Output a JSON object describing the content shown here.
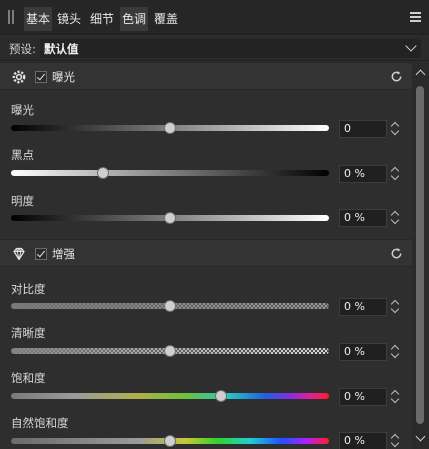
{
  "tabs": [
    {
      "label": "基本",
      "active": true
    },
    {
      "label": "镜头",
      "active": false
    },
    {
      "label": "细节",
      "active": false
    },
    {
      "label": "色调",
      "active": false
    },
    {
      "label": "覆盖",
      "active": false
    }
  ],
  "preset": {
    "label": "预设:",
    "value": "默认值"
  },
  "sections": {
    "exposure": {
      "title": "曝光",
      "enabled": true,
      "controls": {
        "exposure": {
          "label": "曝光",
          "value": "0",
          "level": 0.5
        },
        "black_point": {
          "label": "黑点",
          "value": "0 %",
          "level": 0.29
        },
        "brightness": {
          "label": "明度",
          "value": "0 %",
          "level": 0.5
        }
      }
    },
    "enhance": {
      "title": "增强",
      "enabled": true,
      "controls": {
        "contrast": {
          "label": "对比度",
          "value": "0 %",
          "level": 0.5
        },
        "clarity": {
          "label": "清晰度",
          "value": "0 %",
          "level": 0.5
        },
        "saturation": {
          "label": "饱和度",
          "value": "0 %",
          "level": 0.66
        },
        "vibrance": {
          "label": "自然饱和度",
          "value": "0 %",
          "level": 0.5
        }
      }
    }
  },
  "scrollbar": {
    "position": 0.0
  }
}
